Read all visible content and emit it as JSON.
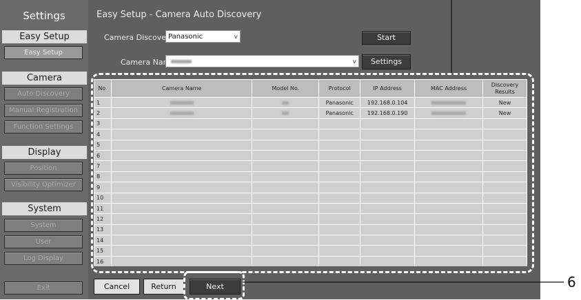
{
  "sidebar": {
    "title": "Settings",
    "sections": [
      {
        "heading": "Easy Setup",
        "items": [
          "Easy Setup"
        ]
      },
      {
        "heading": "Camera",
        "items": [
          "Auto Discovery",
          "Manual Registration",
          "Function Settings"
        ]
      },
      {
        "heading": "Display",
        "items": [
          "Position",
          "Visibility Optimizer"
        ]
      },
      {
        "heading": "System",
        "items": [
          "System",
          "User",
          "Log Display"
        ]
      }
    ],
    "exit": "Exit"
  },
  "main": {
    "title": "Easy Setup - Camera Auto Discovery",
    "camera_discovery_label": "Camera Discovery",
    "camera_discovery_value": "Panasonic",
    "camera_name_label": "Camera Name",
    "start_button": "Start",
    "settings_button": "Settings",
    "columns": [
      "No.",
      "Camera Name",
      "Model No.",
      "Protocol",
      "IP Address",
      "MAC Address",
      "Discovery Results"
    ],
    "rows": [
      {
        "no": "1",
        "protocol": "Panasonic",
        "ip": "192.168.0.104",
        "result": "New"
      },
      {
        "no": "2",
        "protocol": "Panasonic",
        "ip": "192.168.0.190",
        "result": "New"
      },
      {
        "no": "3"
      },
      {
        "no": "4"
      },
      {
        "no": "5"
      },
      {
        "no": "6"
      },
      {
        "no": "7"
      },
      {
        "no": "8"
      },
      {
        "no": "9"
      },
      {
        "no": "10"
      },
      {
        "no": "11"
      },
      {
        "no": "12"
      },
      {
        "no": "13"
      },
      {
        "no": "14"
      },
      {
        "no": "15"
      },
      {
        "no": "16"
      }
    ],
    "cancel_button": "Cancel",
    "return_button": "Return",
    "next_button": "Next"
  },
  "callout": {
    "number": "6"
  }
}
